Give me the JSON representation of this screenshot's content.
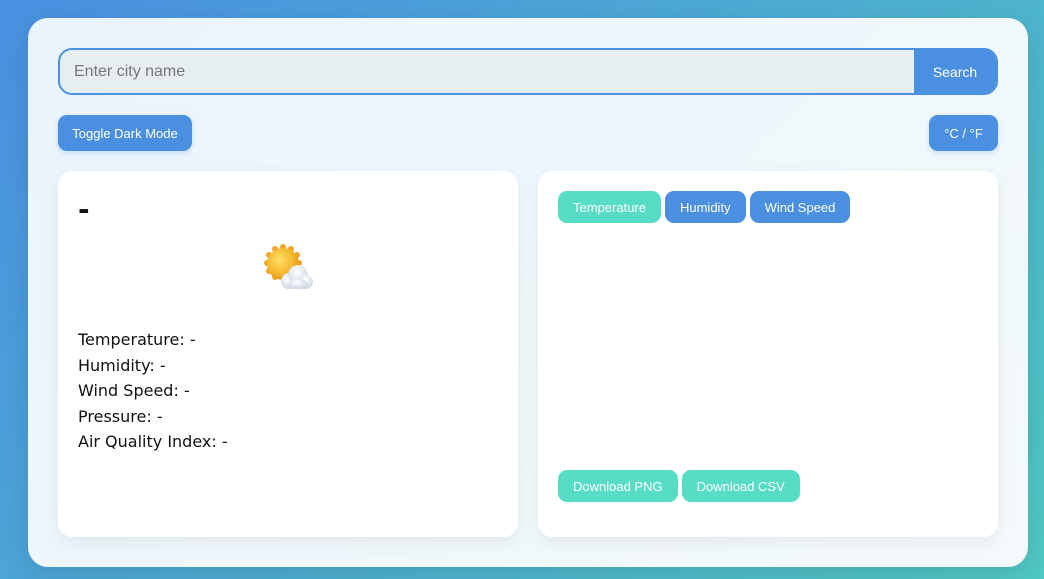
{
  "search": {
    "placeholder": "Enter city name",
    "value": "",
    "button_label": "Search"
  },
  "controls": {
    "dark_mode_label": "Toggle Dark Mode",
    "unit_toggle_label": "°C / °F"
  },
  "current_weather": {
    "city": "-",
    "icon": "sun-behind-cloud-icon",
    "stats": [
      {
        "label": "Temperature:",
        "value": "-"
      },
      {
        "label": "Humidity:",
        "value": "-"
      },
      {
        "label": "Wind Speed:",
        "value": "-"
      },
      {
        "label": "Pressure:",
        "value": "-"
      },
      {
        "label": "Air Quality Index:",
        "value": "-"
      }
    ]
  },
  "chart_panel": {
    "tabs": [
      {
        "label": "Temperature",
        "active": true
      },
      {
        "label": "Humidity",
        "active": false
      },
      {
        "label": "Wind Speed",
        "active": false
      }
    ],
    "download_png_label": "Download PNG",
    "download_csv_label": "Download CSV"
  },
  "colors": {
    "accent_blue": "#4a8fe0",
    "accent_teal": "#57dcc6"
  }
}
